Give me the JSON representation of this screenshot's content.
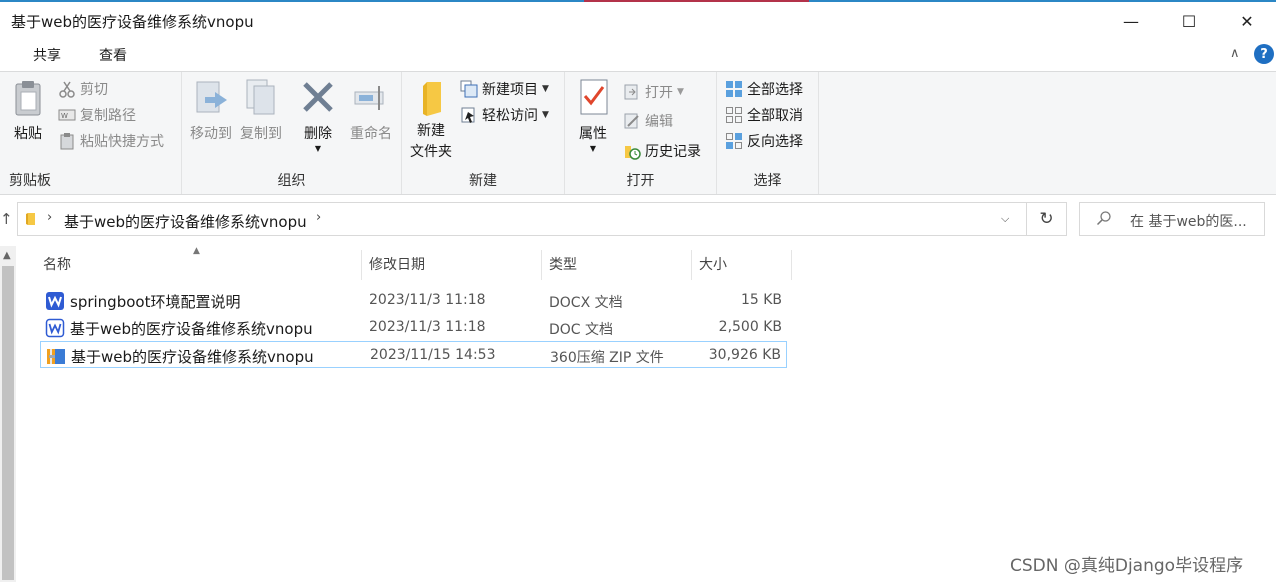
{
  "window": {
    "title": "基于web的医疗设备维修系统vnopu",
    "minimize": "—",
    "maximize": "☐",
    "close": "✕"
  },
  "ribbon_tabs": [
    "共享",
    "查看"
  ],
  "ribbon_controls": {
    "collapse": "∧",
    "help": "?"
  },
  "ribbon": {
    "clipboard": {
      "label": "剪贴板",
      "paste": "粘贴",
      "cut": "剪切",
      "copy_path": "复制路径",
      "paste_shortcut": "粘贴快捷方式"
    },
    "organize": {
      "label": "组织",
      "move_to": "移动到",
      "copy_to": "复制到",
      "delete": "删除",
      "rename": "重命名"
    },
    "new": {
      "label": "新建",
      "new_folder_line1": "新建",
      "new_folder_line2": "文件夹",
      "new_item": "新建项目",
      "easy_access": "轻松访问"
    },
    "open": {
      "label": "打开",
      "properties": "属性",
      "open": "打开",
      "edit": "编辑",
      "history": "历史记录"
    },
    "select": {
      "label": "选择",
      "select_all": "全部选择",
      "select_none": "全部取消",
      "invert": "反向选择"
    }
  },
  "address": {
    "path": "基于web的医疗设备维修系统vnopu",
    "search_placeholder": "在 基于web的医..."
  },
  "columns": [
    "名称",
    "修改日期",
    "类型",
    "大小"
  ],
  "files": [
    {
      "name": "springboot环境配置说明",
      "date": "2023/11/3 11:18",
      "type": "DOCX 文档",
      "size": "15 KB",
      "icon": "wps-docx-icon"
    },
    {
      "name": "基于web的医疗设备维修系统vnopu",
      "date": "2023/11/3 11:18",
      "type": "DOC 文档",
      "size": "2,500 KB",
      "icon": "wps-doc-icon"
    },
    {
      "name": "基于web的医疗设备维修系统vnopu",
      "date": "2023/11/15 14:53",
      "type": "360压缩 ZIP 文件",
      "size": "30,926 KB",
      "icon": "zip-archive-icon"
    }
  ],
  "watermark": "CSDN @真纯Django毕设程序",
  "colors": {
    "accent": "#2b87c5",
    "selection": "#99d1ff",
    "wps_blue": "#2f5bd3"
  }
}
